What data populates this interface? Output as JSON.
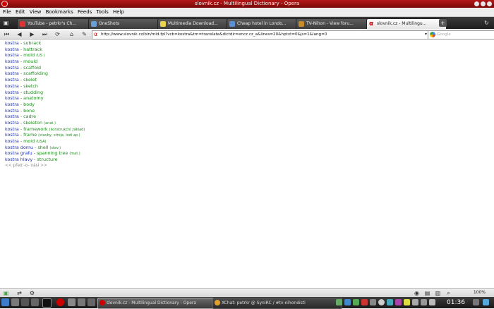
{
  "window": {
    "title": "slovnik.cz - Multilingual Dictionary - Opera"
  },
  "menu": [
    "File",
    "Edit",
    "View",
    "Bookmarks",
    "Feeds",
    "Tools",
    "Help"
  ],
  "tabs": [
    {
      "label": "YouTube - petrkr's Ch...",
      "icon": "youtube-icon",
      "color": "#d33"
    },
    {
      "label": "OneShots",
      "icon": "page-icon",
      "color": "#6a9fd8"
    },
    {
      "label": "Multimedia Download...",
      "icon": "download-icon",
      "color": "#e8d44d"
    },
    {
      "label": "Cheap hotel in Londo...",
      "icon": "hotel-icon",
      "color": "#5c8fd6"
    },
    {
      "label": "TV-Nihon - View foru...",
      "icon": "forum-icon",
      "color": "#c88b2a"
    },
    {
      "label": "slovnik.cz - Multilingu...",
      "icon": "opera-icon",
      "color": "#c00",
      "active": true
    }
  ],
  "address": {
    "url": "http://www.slovnik.cz/bin/mld.fpl?vcb=kostra&trn=translate&dictdir=encz.cz_a&lines=20&hptxt=0&js=1&lang=0",
    "search_placeholder": "Google"
  },
  "results": [
    {
      "cz": "kostra",
      "en": "subrack",
      "note": ""
    },
    {
      "cz": "kostra",
      "en": "hattrack",
      "note": ""
    },
    {
      "cz": "kostra",
      "en": "mold",
      "note": "(US )"
    },
    {
      "cz": "kostra",
      "en": "mould",
      "note": ""
    },
    {
      "cz": "kostra",
      "en": "scaffold",
      "note": ""
    },
    {
      "cz": "kostra",
      "en": "scaffolding",
      "note": ""
    },
    {
      "cz": "kostra",
      "en": "skelet",
      "note": ""
    },
    {
      "cz": "kostra",
      "en": "sketch",
      "note": ""
    },
    {
      "cz": "kostra",
      "en": "studding",
      "note": ""
    },
    {
      "cz": "kostra",
      "en": "anatomy",
      "note": ""
    },
    {
      "cz": "kostra",
      "en": "body",
      "note": ""
    },
    {
      "cz": "kostra",
      "en": "bone",
      "note": ""
    },
    {
      "cz": "kostra",
      "en": "cadre",
      "note": ""
    },
    {
      "cz": "kostra",
      "en": "skeleton",
      "note": "(anat.)"
    },
    {
      "cz": "kostra",
      "en": "framework",
      "note": "(konstrukční základ)"
    },
    {
      "cz": "kostra",
      "en": "frame",
      "note": "(stavby, stroje, lodi ap.)"
    },
    {
      "cz": "kostra",
      "en": "mold",
      "note": "(USA)"
    },
    {
      "cz": "kostra domu",
      "en": "shell",
      "note": "(stav.)"
    },
    {
      "cz": "kostra grafu",
      "en": "spanning tree",
      "note": "(mat.)"
    },
    {
      "cz": "kostra hlavy",
      "en": "structure",
      "note": ""
    }
  ],
  "separator": "-",
  "pager": {
    "prev": "<< před",
    "mid": "-o-",
    "next": "násl >>"
  },
  "statusbar": {
    "zoom": "100%"
  },
  "taskbar": {
    "tasks": [
      {
        "label": "slovnik.cz - Multilingual Dictionary - Opera",
        "icon": "opera-icon",
        "color": "#c00"
      },
      {
        "label": "XChat: petrkr @ SynIRC / #tv-nihondisti",
        "icon": "xchat-icon",
        "color": "#e0a030"
      }
    ],
    "clock": "01:36"
  }
}
